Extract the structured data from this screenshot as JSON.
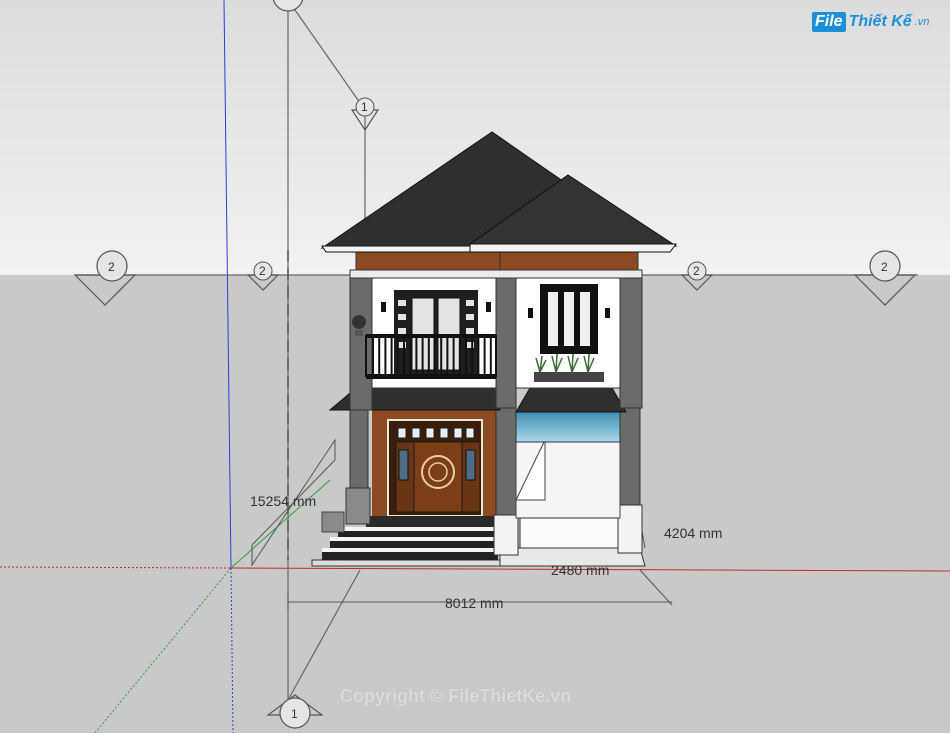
{
  "app": {
    "logo_box": "File",
    "logo_text": "Thiết Kế",
    "logo_suffix": ".vn",
    "watermark": "Copyright © FileThietKe.vn"
  },
  "model": {
    "grid_markers": {
      "row_label": "2",
      "col_label": "1"
    },
    "dimensions": {
      "height": "15254 mm",
      "side": "4204 mm",
      "garage": "2480 mm",
      "width": "8012 mm"
    }
  },
  "colors": {
    "sky": "#e8e8e8",
    "ground": "#c9c9c9",
    "roof": "#2f2f2f",
    "wall": "#ffffff",
    "wood": "#8a4a22",
    "pillar": "#6b6b6b",
    "glass": "#5aa9c8",
    "axis_red": "#c62828",
    "axis_green": "#2e9e3a",
    "axis_blue": "#2b3fd8"
  }
}
